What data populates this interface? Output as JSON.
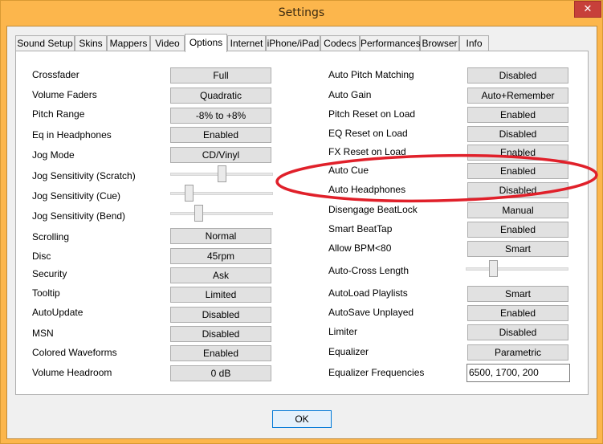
{
  "window": {
    "title": "Settings",
    "close_glyph": "✕"
  },
  "tabs": [
    {
      "label": "Sound Setup"
    },
    {
      "label": "Skins"
    },
    {
      "label": "Mappers"
    },
    {
      "label": "Video"
    },
    {
      "label": "Options",
      "active": true
    },
    {
      "label": "Internet"
    },
    {
      "label": "iPhone/iPad"
    },
    {
      "label": "Codecs"
    },
    {
      "label": "Performances"
    },
    {
      "label": "Browser"
    },
    {
      "label": "Info"
    }
  ],
  "left": {
    "crossfader": {
      "label": "Crossfader",
      "value": "Full"
    },
    "volume_faders": {
      "label": "Volume Faders",
      "value": "Quadratic"
    },
    "pitch_range": {
      "label": "Pitch Range",
      "value": "-8% to +8%"
    },
    "eq_in_headphones": {
      "label": "Eq in Headphones",
      "value": "Enabled"
    },
    "jog_mode": {
      "label": "Jog Mode",
      "value": "CD/Vinyl"
    },
    "jog_sens_scratch": {
      "label": "Jog Sensitivity (Scratch)",
      "level": 0.5
    },
    "jog_sens_cue": {
      "label": "Jog Sensitivity (Cue)",
      "level": 0.15
    },
    "jog_sens_bend": {
      "label": "Jog Sensitivity (Bend)",
      "level": 0.26
    },
    "scrolling": {
      "label": "Scrolling",
      "value": "Normal"
    },
    "disc": {
      "label": "Disc",
      "value": "45rpm"
    },
    "security": {
      "label": "Security",
      "value": "Ask"
    },
    "tooltip": {
      "label": "Tooltip",
      "value": "Limited"
    },
    "autoupdate": {
      "label": "AutoUpdate",
      "value": "Disabled"
    },
    "msn": {
      "label": "MSN",
      "value": "Disabled"
    },
    "colored_waveforms": {
      "label": "Colored Waveforms",
      "value": "Enabled"
    },
    "volume_headroom": {
      "label": "Volume Headroom",
      "value": "0 dB"
    }
  },
  "right": {
    "auto_pitch_matching": {
      "label": "Auto Pitch Matching",
      "value": "Disabled"
    },
    "auto_gain": {
      "label": "Auto Gain",
      "value": "Auto+Remember"
    },
    "pitch_reset_on_load": {
      "label": "Pitch Reset on Load",
      "value": "Enabled"
    },
    "eq_reset_on_load": {
      "label": "EQ Reset on Load",
      "value": "Disabled"
    },
    "fx_reset_on_load": {
      "label": "FX Reset on Load",
      "value": "Enabled"
    },
    "auto_cue": {
      "label": "Auto Cue",
      "value": "Enabled"
    },
    "auto_headphones": {
      "label": "Auto Headphones",
      "value": "Disabled"
    },
    "disengage_beatlock": {
      "label": "Disengage BeatLock",
      "value": "Manual"
    },
    "smart_beattap": {
      "label": "Smart BeatTap",
      "value": "Enabled"
    },
    "allow_bpm80": {
      "label": "Allow BPM<80",
      "value": "Smart"
    },
    "auto_cross_length": {
      "label": "Auto-Cross Length",
      "level": 0.25
    },
    "autoload_playlists": {
      "label": "AutoLoad Playlists",
      "value": "Smart"
    },
    "autosave_unplayed": {
      "label": "AutoSave Unplayed",
      "value": "Enabled"
    },
    "limiter": {
      "label": "Limiter",
      "value": "Disabled"
    },
    "equalizer": {
      "label": "Equalizer",
      "value": "Parametric"
    },
    "equalizer_frequencies": {
      "label": "Equalizer Frequencies",
      "value": "6500, 1700, 200"
    }
  },
  "footer": {
    "ok_label": "OK"
  },
  "colors": {
    "titlebar": "#fcb64c",
    "close": "#c7403a",
    "annotation": "#e0202a"
  }
}
